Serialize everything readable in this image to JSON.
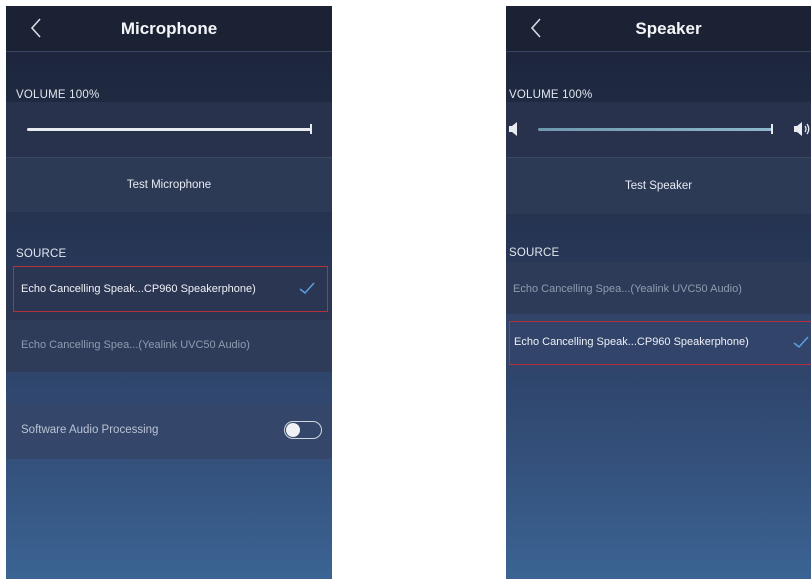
{
  "microphone": {
    "title": "Microphone",
    "volume_label": "VOLUME 100%",
    "volume_level": 1.0,
    "test_button": "Test Microphone",
    "source_label": "SOURCE",
    "sources": [
      {
        "label": "Echo Cancelling Speak...CP960 Speakerphone)",
        "selected": true
      },
      {
        "label": "Echo Cancelling Spea...(Yealink UVC50 Audio)",
        "selected": false
      }
    ],
    "software_audio_processing": {
      "label": "Software Audio Processing",
      "enabled": false
    }
  },
  "speaker": {
    "title": "Speaker",
    "volume_label": "VOLUME 100%",
    "volume_level": 1.0,
    "test_button": "Test Speaker",
    "source_label": "SOURCE",
    "sources": [
      {
        "label": "Echo Cancelling Spea...(Yealink UVC50 Audio)",
        "selected": false
      },
      {
        "label": "Echo Cancelling Speak...CP960 Speakerphone)",
        "selected": true
      }
    ]
  },
  "icons": {
    "back": "chevron-left-icon",
    "check": "checkmark-icon",
    "volume_down": "speaker-low-icon",
    "volume_up": "speaker-high-icon"
  },
  "colors": {
    "selection_outline": "#b5303f",
    "check": "#5aa0e0",
    "slider_right": "#8fb7cc"
  }
}
